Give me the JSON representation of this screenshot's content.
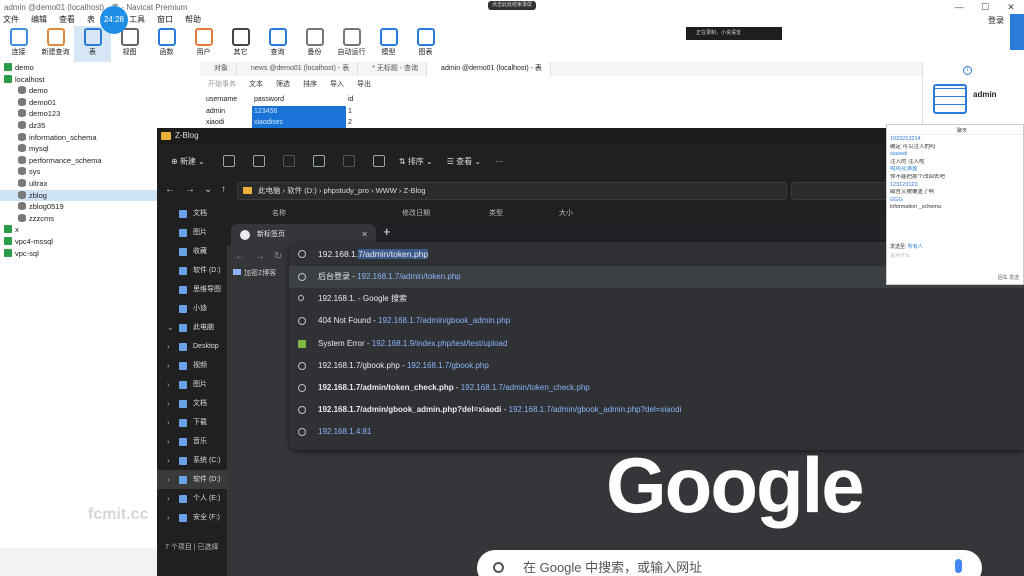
{
  "navicat": {
    "title": "admin @demo01 (localhost) - 表 - Navicat Premium",
    "timer": "24:28",
    "recording_label": "点击此处结束录屏",
    "voice_label": "正在录制，小说语音",
    "menu": [
      "文件",
      "编辑",
      "查看",
      "表",
      "工具",
      "窗口",
      "帮助"
    ],
    "login": "登录",
    "toolbar": [
      {
        "label": "连接",
        "icon": "connection-icon",
        "color": "#3d8ee0"
      },
      {
        "label": "新建查询",
        "icon": "new-query-icon",
        "color": "#e08a3d"
      },
      {
        "label": "表",
        "icon": "table-icon",
        "color": "#2b7bd8"
      },
      {
        "label": "视图",
        "icon": "view-icon",
        "color": "#666666"
      },
      {
        "label": "函数",
        "icon": "function-icon",
        "color": "#2b7bd8"
      },
      {
        "label": "用户",
        "icon": "user-icon",
        "color": "#e07a3d"
      },
      {
        "label": "其它",
        "icon": "other-icon",
        "color": "#444444"
      },
      {
        "label": "查询",
        "icon": "query-icon",
        "color": "#2b7bd8"
      },
      {
        "label": "备份",
        "icon": "backup-icon",
        "color": "#777777"
      },
      {
        "label": "自动运行",
        "icon": "automation-icon",
        "color": "#777777"
      },
      {
        "label": "模型",
        "icon": "model-icon",
        "color": "#2b7bd8"
      },
      {
        "label": "图表",
        "icon": "chart-icon",
        "color": "#2b7bd8"
      }
    ],
    "tree": [
      {
        "label": "demo",
        "type": "conn",
        "indent": 0
      },
      {
        "label": "localhost",
        "type": "conn",
        "indent": 0
      },
      {
        "label": "demo",
        "type": "db",
        "indent": 1
      },
      {
        "label": "demo01",
        "type": "db",
        "indent": 1
      },
      {
        "label": "demo123",
        "type": "db",
        "indent": 1
      },
      {
        "label": "dz35",
        "type": "db",
        "indent": 1
      },
      {
        "label": "information_schema",
        "type": "db",
        "indent": 1
      },
      {
        "label": "mysql",
        "type": "db",
        "indent": 1
      },
      {
        "label": "performance_schema",
        "type": "db",
        "indent": 1
      },
      {
        "label": "sys",
        "type": "db",
        "indent": 1
      },
      {
        "label": "ultrax",
        "type": "db",
        "indent": 1
      },
      {
        "label": "zblog",
        "type": "db",
        "indent": 1,
        "selected": true
      },
      {
        "label": "zblog0519",
        "type": "db",
        "indent": 1
      },
      {
        "label": "zzzcms",
        "type": "db",
        "indent": 1
      },
      {
        "label": "x",
        "type": "conn",
        "indent": 0
      },
      {
        "label": "vpc4-mssql",
        "type": "conn",
        "indent": 0
      },
      {
        "label": "vpc-sql",
        "type": "conn",
        "indent": 0
      }
    ],
    "tabs": [
      "对象",
      "news @demo01 (localhost) - 表",
      "* 无标题 - 查询",
      "admin @demo01 (localhost) - 表"
    ],
    "grid_tools": {
      "begin": "开始事务",
      "text": "文本",
      "filter": "筛选",
      "sort": "排序",
      "import": "导入",
      "export": "导出"
    },
    "grid": {
      "columns": [
        "username",
        "password",
        "id"
      ],
      "rows": [
        [
          "admin",
          "123456",
          "1"
        ],
        [
          "xiaodi",
          "xiaodisec",
          "2"
        ]
      ]
    },
    "right_panel": {
      "name": "admin",
      "sub": "表"
    },
    "watermark": "fcmit.cc"
  },
  "explorer": {
    "title": "Z-Blog",
    "commands": {
      "new": "新建",
      "sort": "排序",
      "view": "查看"
    },
    "path": [
      "此电脑",
      "软件 (D:)",
      "phpstudy_pro",
      "WWW",
      "Z-Blog"
    ],
    "columns": [
      "名称",
      "修改日期",
      "类型",
      "大小"
    ],
    "sidebar": [
      {
        "label": "文档",
        "chev": ""
      },
      {
        "label": "图片",
        "chev": ""
      },
      {
        "label": "收藏",
        "chev": ""
      },
      {
        "label": "软件 (D:)",
        "chev": ""
      },
      {
        "label": "思维导图",
        "chev": ""
      },
      {
        "label": "小迪",
        "chev": ""
      },
      {
        "label": "此电脑",
        "chev": "⌄"
      },
      {
        "label": "Desktop",
        "chev": "›"
      },
      {
        "label": "视频",
        "chev": "›"
      },
      {
        "label": "图片",
        "chev": "›"
      },
      {
        "label": "文档",
        "chev": "›"
      },
      {
        "label": "下载",
        "chev": "›"
      },
      {
        "label": "音乐",
        "chev": "›"
      },
      {
        "label": "系统 (C:)",
        "chev": "›"
      },
      {
        "label": "软件 (D:)",
        "chev": "›",
        "selected": true
      },
      {
        "label": "个人 (E:)",
        "chev": "›"
      },
      {
        "label": "安全 (F:)",
        "chev": "›"
      }
    ],
    "status": "7 个项目  |  已选择"
  },
  "chrome": {
    "tab_title": "新标签页",
    "bookmark": "加密Z博客",
    "omnibox_typed": "192.168.1.",
    "omnibox_selected": "7/admin/token.php",
    "suggestions": [
      {
        "title": "后台登录",
        "sep": " - ",
        "url": "192.168.1.7/admin/token.php",
        "icon": "globe",
        "highlight": true
      },
      {
        "title": "192.168.1.",
        "sep": " - ",
        "url": "Google 搜索",
        "icon": "search",
        "plain_url": true
      },
      {
        "title": "404 Not Found",
        "sep": " - ",
        "url": "192.168.1.7/admin/gbook_admin.php",
        "icon": "globe"
      },
      {
        "title": "System Error",
        "sep": " - ",
        "url": "192.168.1.9/index.php/test/test/upload",
        "icon": "square"
      },
      {
        "title": "192.168.1.7/gbook.php",
        "sep": " - ",
        "url": "192.168.1.7/gbook.php",
        "icon": "globe"
      },
      {
        "title": "192.168.1.7/admin/token_check.php",
        "sep": " - ",
        "url": "192.168.1.7/admin/token_check.php",
        "icon": "globe",
        "bold": true
      },
      {
        "title": "192.168.1.7/admin/gbook_admin.php?del=xiaodi",
        "sep": " - ",
        "url": "192.168.1.7/admin/gbook_admin.php?del=xiaodi",
        "icon": "globe",
        "bold": true
      },
      {
        "title": "",
        "sep": "",
        "url": "192.168.1.4:81",
        "icon": "globe"
      }
    ],
    "google_logo": "Google",
    "search_placeholder": "在 Google 中搜索，或输入网址"
  },
  "chat": {
    "title": "聊天",
    "messages": [
      {
        "text": "1023213214",
        "blue": true
      },
      {
        "text": "确定 可以注入的吗",
        "blue": false
      },
      {
        "text": "xiaoedi",
        "blue": true
      },
      {
        "text": "注入的 注入啦",
        "blue": false
      },
      {
        "text": "哦风花满盈",
        "blue": true
      },
      {
        "text": "你不能把那个改回去吧",
        "blue": false
      },
      {
        "text": "123123123",
        "blue": true
      },
      {
        "text": "磁吾又被覆盖了啊",
        "blue": false
      },
      {
        "text": "GGG",
        "blue": true
      },
      {
        "text": "information _schema",
        "blue": false
      }
    ],
    "send_to_label": "发送至:",
    "send_to_value": "所有人",
    "input_placeholder": "说点什么",
    "footer": "回车 发送"
  }
}
